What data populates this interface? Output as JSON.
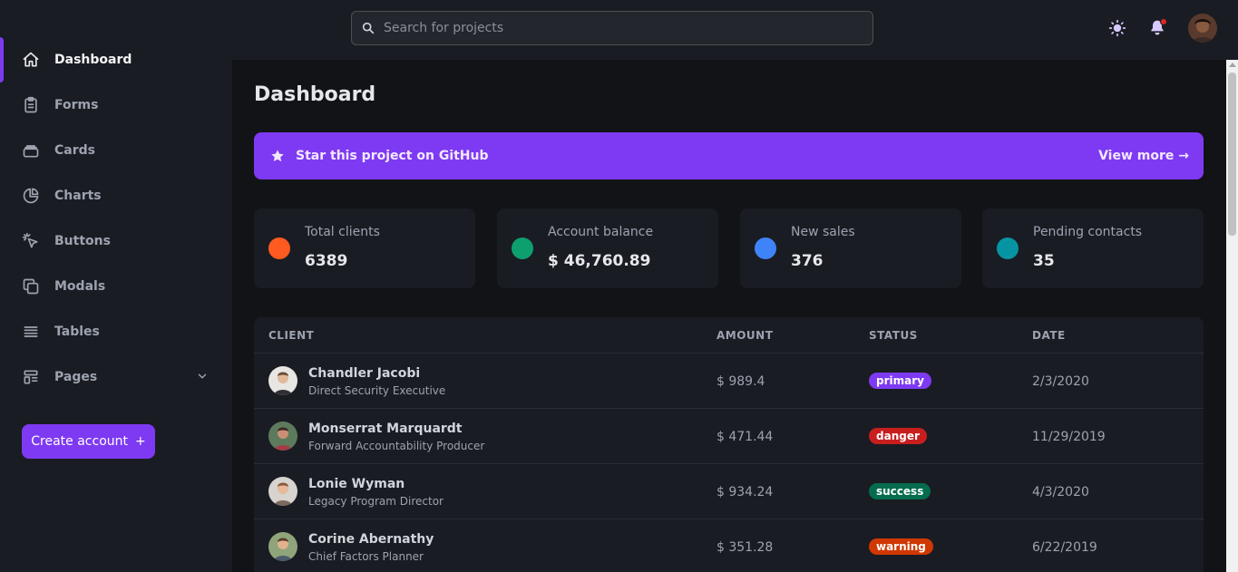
{
  "sidebar": {
    "items": [
      {
        "label": "Dashboard",
        "icon": "home-icon"
      },
      {
        "label": "Forms",
        "icon": "clipboard-icon"
      },
      {
        "label": "Cards",
        "icon": "cards-icon"
      },
      {
        "label": "Charts",
        "icon": "pie-chart-icon"
      },
      {
        "label": "Buttons",
        "icon": "cursor-click-icon"
      },
      {
        "label": "Modals",
        "icon": "duplicate-icon"
      },
      {
        "label": "Tables",
        "icon": "table-lines-icon"
      },
      {
        "label": "Pages",
        "icon": "pages-icon"
      }
    ],
    "create_account": "Create account",
    "create_plus": "+"
  },
  "header": {
    "search_placeholder": "Search for projects"
  },
  "main": {
    "title": "Dashboard",
    "banner": {
      "text": "Star this project on GitHub",
      "link": "View more →"
    },
    "cards": [
      {
        "label": "Total clients",
        "value": "6389",
        "color": "#ff5a1f"
      },
      {
        "label": "Account balance",
        "value": "$ 46,760.89",
        "color": "#0e9f6e"
      },
      {
        "label": "New sales",
        "value": "376",
        "color": "#3f83f8"
      },
      {
        "label": "Pending contacts",
        "value": "35",
        "color": "#0694a2"
      }
    ],
    "table": {
      "headers": {
        "client": "CLIENT",
        "amount": "AMOUNT",
        "status": "STATUS",
        "date": "DATE"
      },
      "rows": [
        {
          "name": "Chandler Jacobi",
          "role": "Direct Security Executive",
          "amount": "$ 989.4",
          "status": "primary",
          "status_color": "#7e3af2",
          "date": "2/3/2020"
        },
        {
          "name": "Monserrat Marquardt",
          "role": "Forward Accountability Producer",
          "amount": "$ 471.44",
          "status": "danger",
          "status_color": "#c81e1e",
          "date": "11/29/2019"
        },
        {
          "name": "Lonie Wyman",
          "role": "Legacy Program Director",
          "amount": "$ 934.24",
          "status": "success",
          "status_color": "#046c4e",
          "date": "4/3/2020"
        },
        {
          "name": "Corine Abernathy",
          "role": "Chief Factors Planner",
          "amount": "$ 351.28",
          "status": "warning",
          "status_color": "#d03801",
          "date": "6/22/2019"
        }
      ]
    }
  }
}
